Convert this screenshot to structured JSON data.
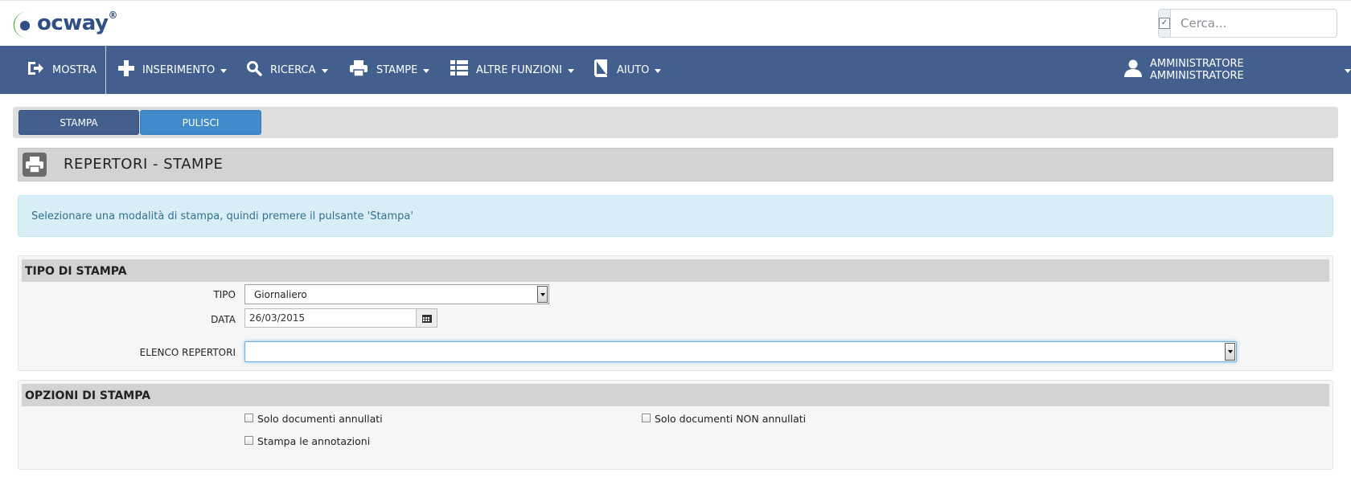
{
  "header": {
    "logo_text": "ocway",
    "logo_reg": "®",
    "search": {
      "placeholder": "Cerca...",
      "value": ""
    }
  },
  "navbar": {
    "items": [
      {
        "label": "MOSTRA",
        "icon": "sign-out-icon"
      },
      {
        "label": "INSERIMENTO",
        "icon": "plus-icon"
      },
      {
        "label": "RICERCA",
        "icon": "search-icon"
      },
      {
        "label": "STAMPE",
        "icon": "print-icon"
      },
      {
        "label": "ALTRE FUNZIONI",
        "icon": "list-icon"
      },
      {
        "label": "AIUTO",
        "icon": "book-icon"
      }
    ],
    "user": {
      "label": "AMMINISTRATORE AMMINISTRATORE",
      "icon": "user-icon"
    }
  },
  "toolbar": {
    "stampa_label": "STAMPA",
    "pulisci_label": "PULISCI"
  },
  "page": {
    "title": "REPERTORI - STAMPE",
    "info": "Selezionare una modalità di stampa, quindi premere il pulsante 'Stampa'"
  },
  "tipo_di_stampa": {
    "legend": "TIPO DI STAMPA",
    "tipo_label": "TIPO",
    "tipo_value": "Giornaliero",
    "data_label": "DATA",
    "data_value": "26/03/2015",
    "elenco_label": "ELENCO REPERTORI",
    "elenco_value": ""
  },
  "opzioni_di_stampa": {
    "legend": "OPZIONI DI STAMPA",
    "options": [
      {
        "label": "Solo documenti annullati",
        "checked": false
      },
      {
        "label": "Solo documenti NON annullati",
        "checked": false
      },
      {
        "label": "Stampa le annotazioni",
        "checked": false
      }
    ]
  },
  "colors": {
    "navbar": "#435f8e",
    "primary_button": "#435f8e",
    "info_button": "#428bca",
    "alert_bg": "#d9edf7",
    "alert_text": "#31708f",
    "logo_green": "#3aa935",
    "logo_blue": "#2f4f86"
  }
}
